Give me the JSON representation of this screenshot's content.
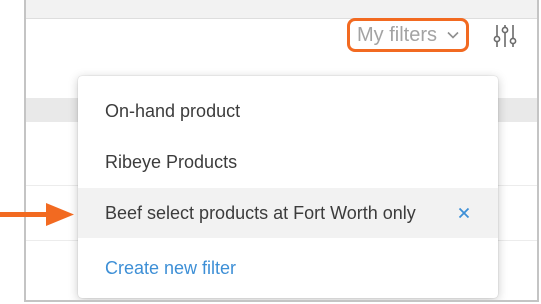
{
  "toolbar": {
    "my_filters_label": "My filters",
    "dropdown_icon": "chevron-down-icon",
    "settings_icon": "sliders-icon"
  },
  "filter_menu": {
    "items": [
      {
        "label": "On-hand product",
        "selected": false
      },
      {
        "label": "Ribeye Products",
        "selected": false
      },
      {
        "label": "Beef select products at Fort Worth only",
        "selected": true,
        "remove_icon": "close-icon"
      }
    ],
    "create_label": "Create new filter"
  },
  "colors": {
    "accent_orange": "#f26a21",
    "link_blue": "#3d8fd6",
    "text_grey": "#a3a3a3",
    "text_dark": "#3c3c3c",
    "selected_bg": "#f2f2f2"
  }
}
